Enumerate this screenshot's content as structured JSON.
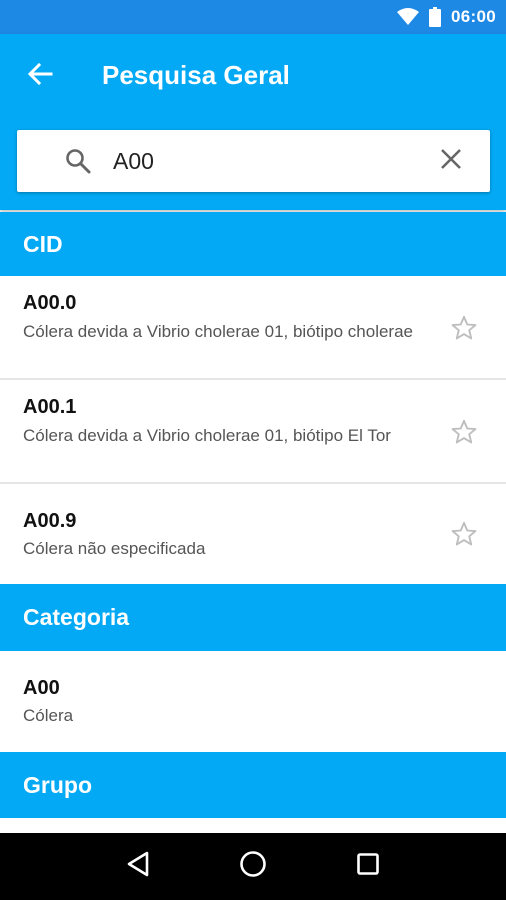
{
  "status_bar": {
    "time": "06:00",
    "icons": [
      "wifi-icon",
      "battery-icon"
    ]
  },
  "app_bar": {
    "title": "Pesquisa Geral",
    "back_icon": "arrow-back-icon"
  },
  "search": {
    "value": "A00",
    "icon": "search-icon",
    "clear_icon": "close-icon"
  },
  "sections": {
    "cid": {
      "title": "CID",
      "items": [
        {
          "code": "A00.0",
          "description": "Cólera devida a Vibrio cholerae 01, biótipo cholerae"
        },
        {
          "code": "A00.1",
          "description": "Cólera devida a Vibrio cholerae 01, biótipo El Tor"
        },
        {
          "code": "A00.9",
          "description": "Cólera não especificada"
        }
      ]
    },
    "categoria": {
      "title": "Categoria",
      "items": [
        {
          "code": "A00",
          "description": "Cólera"
        }
      ]
    },
    "grupo": {
      "title": "Grupo"
    }
  },
  "nav_bar": {
    "buttons": [
      "back-triangle-icon",
      "home-circle-icon",
      "recents-square-icon"
    ]
  },
  "colors": {
    "status_bar": "#1e88e5",
    "primary": "#03a9f4",
    "star": "#bdbdbd"
  }
}
